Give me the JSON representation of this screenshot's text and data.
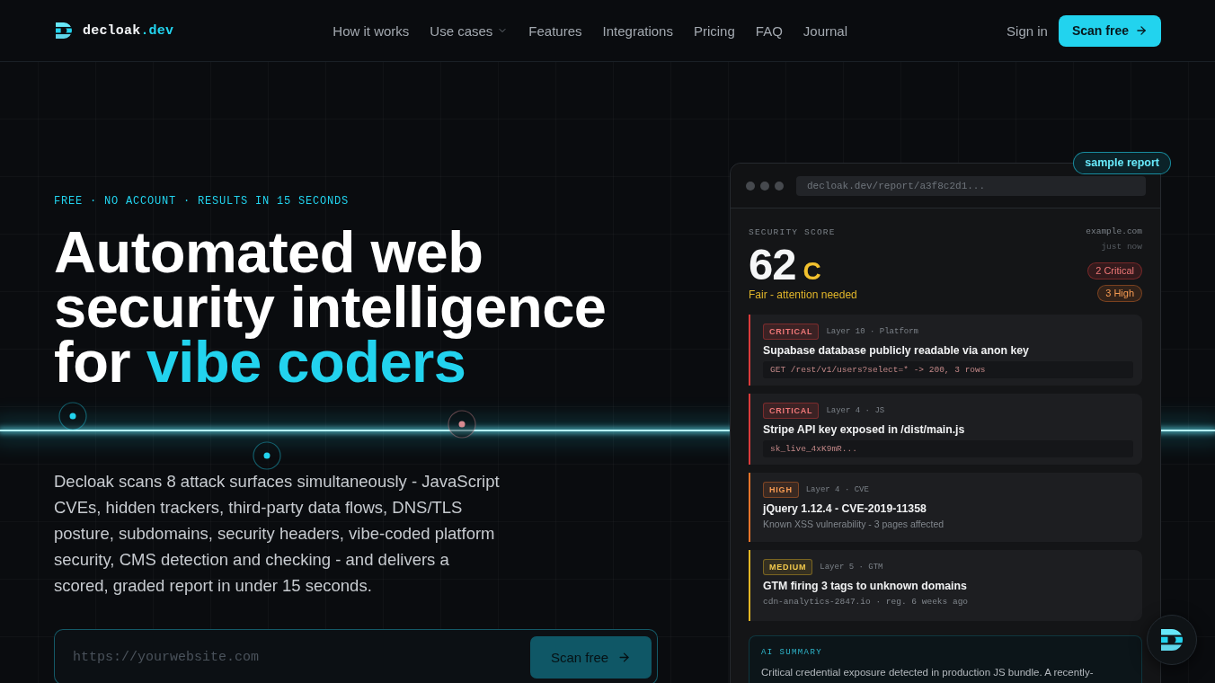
{
  "header": {
    "brand": {
      "name": "decloak",
      "suffix": ".dev"
    },
    "nav": [
      {
        "label": "How it works",
        "has_menu": false
      },
      {
        "label": "Use cases",
        "has_menu": true
      },
      {
        "label": "Features",
        "has_menu": false
      },
      {
        "label": "Integrations",
        "has_menu": false
      },
      {
        "label": "Pricing",
        "has_menu": false
      },
      {
        "label": "FAQ",
        "has_menu": false
      },
      {
        "label": "Journal",
        "has_menu": false
      }
    ],
    "sign_in": "Sign in",
    "cta": "Scan free"
  },
  "hero": {
    "eyebrow": "FREE · NO ACCOUNT · RESULTS IN 15 SECONDS",
    "headline": "Automated web security intelligence for",
    "headline_highlight": "vibe coders",
    "description": "Decloak scans 8 attack surfaces simultaneously - JavaScript CVEs, hidden trackers, third-party data flows, DNS/TLS posture, subdomains, security headers, vibe-coded platform security, CMS detection and checking - and delivers a scored, graded report in under 15 seconds.",
    "scan_form": {
      "placeholder": "https://yourwebsite.com",
      "button": "Scan free"
    }
  },
  "report": {
    "badge": "sample report",
    "url": "decloak.dev/report/a3f8c2d1...",
    "score_label": "SECURITY SCORE",
    "score": "62",
    "grade": "C",
    "verdict": "Fair - attention needed",
    "site": "example.com",
    "time": "just now",
    "counts": [
      {
        "kind": "critical",
        "label": "2 Critical"
      },
      {
        "kind": "high",
        "label": "3 High"
      }
    ],
    "findings": [
      {
        "kind": "critical",
        "badge": "CRITICAL",
        "meta": "Layer 10 · Platform",
        "title": "Supabase database publicly readable via anon key",
        "detail": {
          "kind": "code",
          "text": "GET /rest/v1/users?select=* -> 200, 3 rows"
        }
      },
      {
        "kind": "critical",
        "badge": "CRITICAL",
        "meta": "Layer 4 · JS",
        "title": "Stripe API key exposed in /dist/main.js",
        "detail": {
          "kind": "code",
          "text": "sk_live_4xK9mR..."
        }
      },
      {
        "kind": "high",
        "badge": "HIGH",
        "meta": "Layer 4 · CVE",
        "title": "jQuery 1.12.4 - CVE-2019-11358",
        "detail": {
          "kind": "note",
          "text": "Known XSS vulnerability - 3 pages affected"
        }
      },
      {
        "kind": "medium",
        "badge": "MEDIUM",
        "meta": "Layer 5 · GTM",
        "title": "GTM firing 3 tags to unknown domains",
        "detail": {
          "kind": "mono",
          "text": "cdn-analytics-2847.io · reg. 6 weeks ago"
        }
      }
    ],
    "ai_summary": {
      "label": "AI SUMMARY",
      "text": "Critical credential exposure detected in production JS bundle. A recently-"
    }
  }
}
